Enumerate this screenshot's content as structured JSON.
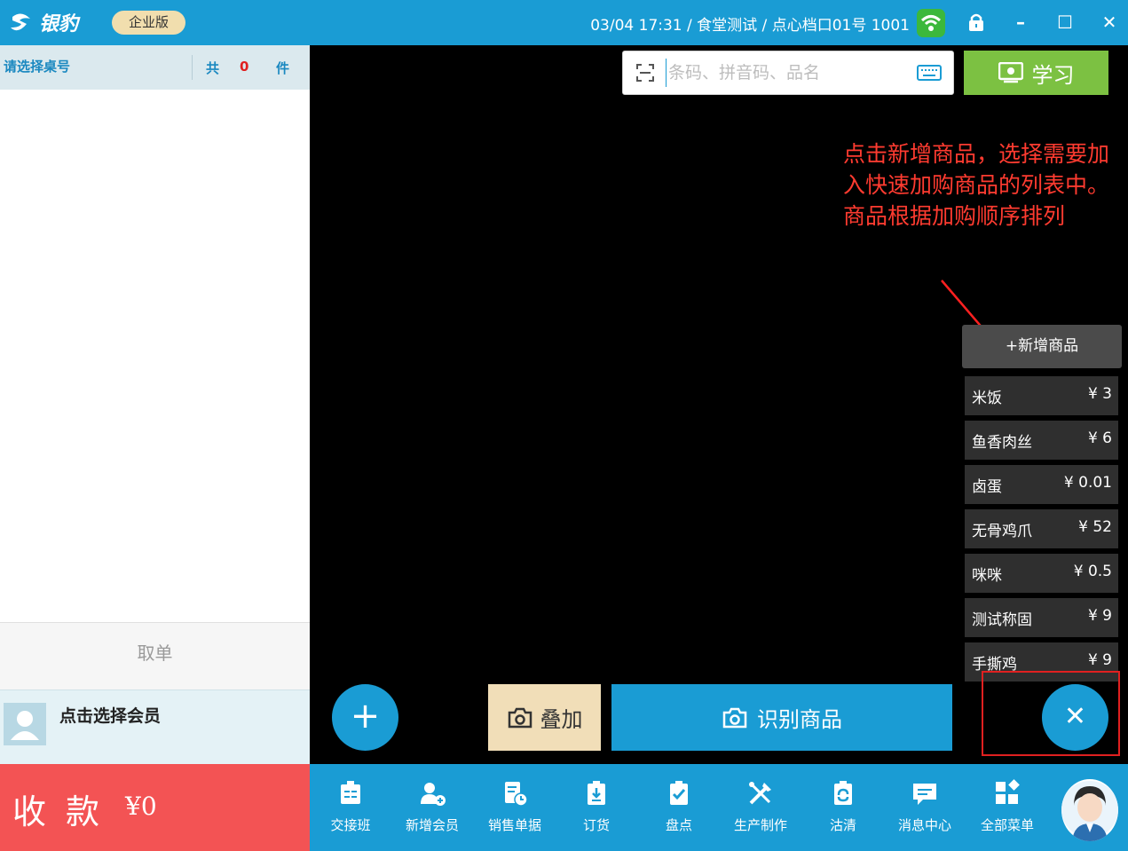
{
  "titlebar": {
    "logo_text": "银豹",
    "edition": "企业版",
    "info": "03/04 17:31 / 食堂测试 / 点心档口01号 1001",
    "icons": [
      "wifi-icon",
      "lock-icon",
      "minimize-icon",
      "maximize-icon",
      "close-icon"
    ],
    "minimize": "–",
    "maximize": "☐",
    "close": "✕"
  },
  "order": {
    "table_select": "请选择桌号",
    "count_label": "共",
    "count_value": "0",
    "count_unit": "件",
    "cancel": "取单",
    "member_prompt": "点击选择会员",
    "pay_label": "收款",
    "pay_amount": "¥0"
  },
  "search": {
    "placeholder": "条码、拼音码、品名",
    "value": ""
  },
  "learn_button": "学习",
  "annotation": "点击新增商品，选择需要加入快速加购商品的列表中。商品根据加购顺序排列",
  "quick_list": {
    "add_label": "+新增商品",
    "items": [
      {
        "name": "米饭",
        "price": "¥ 3"
      },
      {
        "name": "鱼香肉丝",
        "price": "¥ 6"
      },
      {
        "name": "卤蛋",
        "price": "¥ 0.01"
      },
      {
        "name": "无骨鸡爪",
        "price": "¥ 52"
      },
      {
        "name": "咪咪",
        "price": "¥ 0.5"
      },
      {
        "name": "测试称固",
        "price": "¥ 9"
      },
      {
        "name": "手撕鸡",
        "price": "¥ 9"
      }
    ]
  },
  "actions": {
    "plus": "+",
    "stack": "叠加",
    "identify": "识别商品",
    "close_list": "✕"
  },
  "nav": [
    {
      "label": "交接班",
      "icon": "handover-icon"
    },
    {
      "label": "新增会员",
      "icon": "add-member-icon"
    },
    {
      "label": "销售单据",
      "icon": "sales-receipt-icon"
    },
    {
      "label": "订货",
      "icon": "order-goods-icon"
    },
    {
      "label": "盘点",
      "icon": "inventory-check-icon"
    },
    {
      "label": "生产制作",
      "icon": "production-icon"
    },
    {
      "label": "沽清",
      "icon": "sold-out-icon"
    },
    {
      "label": "消息中心",
      "icon": "message-center-icon"
    },
    {
      "label": "全部菜单",
      "icon": "all-menu-icon"
    }
  ],
  "colors": {
    "primary": "#1a9cd4",
    "pay": "#f35354",
    "learn": "#7cc142",
    "annotation": "#ff3b30"
  }
}
